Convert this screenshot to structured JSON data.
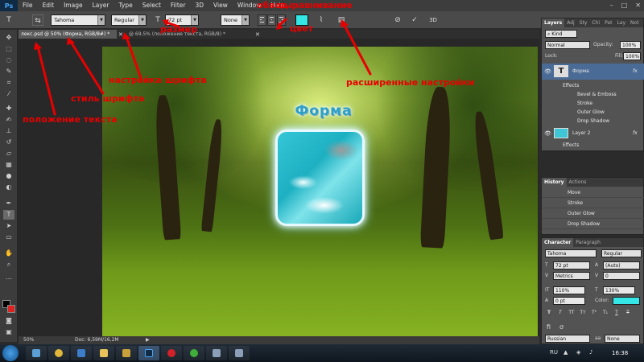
{
  "menubar": {
    "app_logo": "Ps",
    "items": [
      "File",
      "Edit",
      "Image",
      "Layer",
      "Type",
      "Select",
      "Filter",
      "3D",
      "View",
      "Window",
      "Help"
    ]
  },
  "options_bar": {
    "font_family": "Tahoma",
    "font_style": "Regular",
    "font_size": "72 pt",
    "antialias": "None",
    "mode_3d": "3D"
  },
  "doc_tabs": [
    {
      "label": "лекс.psd @ 50% (Форма, RGB/8#) *"
    },
    {
      "label": "@ 69,5% (положение текста, RGB/8) *"
    }
  ],
  "canvas": {
    "title_text": "Форма"
  },
  "annotations": {
    "text_position": "положение текста",
    "font_style": "стиль шрифта",
    "font_settings": "настройка шрифта",
    "size": "размер",
    "alignment": "выравнивание",
    "color": "цвет",
    "warp": "обвод",
    "extended": "расширенные настройки"
  },
  "status_bar": {
    "zoom": "50%",
    "doc_info": "Doc: 6,59M/16,2M"
  },
  "layers_panel": {
    "tabs": [
      "Layers",
      "Adj",
      "Sty",
      "Chi",
      "Pat",
      "Lay",
      "Not"
    ],
    "kind_filter": "Kind",
    "blend_mode": "Normal",
    "opacity_label": "Opacity:",
    "opacity_value": "100%",
    "lock_label": "Lock:",
    "fill_label": "Fill:",
    "fill_value": "100%",
    "layers": [
      {
        "name": "Форма",
        "fx": "fx"
      },
      {
        "name": "Effects"
      },
      {
        "name": "Bevel & Emboss"
      },
      {
        "name": "Stroke"
      },
      {
        "name": "Outer Glow"
      },
      {
        "name": "Drop Shadow"
      },
      {
        "name": "Layer 2",
        "fx": "fx"
      },
      {
        "name": "Effects"
      }
    ]
  },
  "history_panel": {
    "tabs": [
      "History",
      "Actions"
    ],
    "items": [
      "Move",
      "Stroke",
      "Outer Glow",
      "Drop Shadow"
    ]
  },
  "character_panel": {
    "tabs": [
      "Character",
      "Paragraph"
    ],
    "font_family": "Tahoma",
    "font_style": "Regular",
    "size": "72 pt",
    "leading": "(Auto)",
    "kerning": "Metrics",
    "tracking": "0",
    "vertical_scale": "110%",
    "horizontal_scale": "130%",
    "baseline_shift": "0 pt",
    "color_label": "Color:",
    "text_color": "#35e6e6",
    "style_buttons": [
      "T",
      "T",
      "TT",
      "Tт",
      "T¹",
      "T₁",
      "T",
      "T"
    ],
    "language": "Russian",
    "antialias_glyph": "aa",
    "antialias": "None"
  },
  "taskbar": {
    "language": "RU",
    "clock": "16:38"
  }
}
